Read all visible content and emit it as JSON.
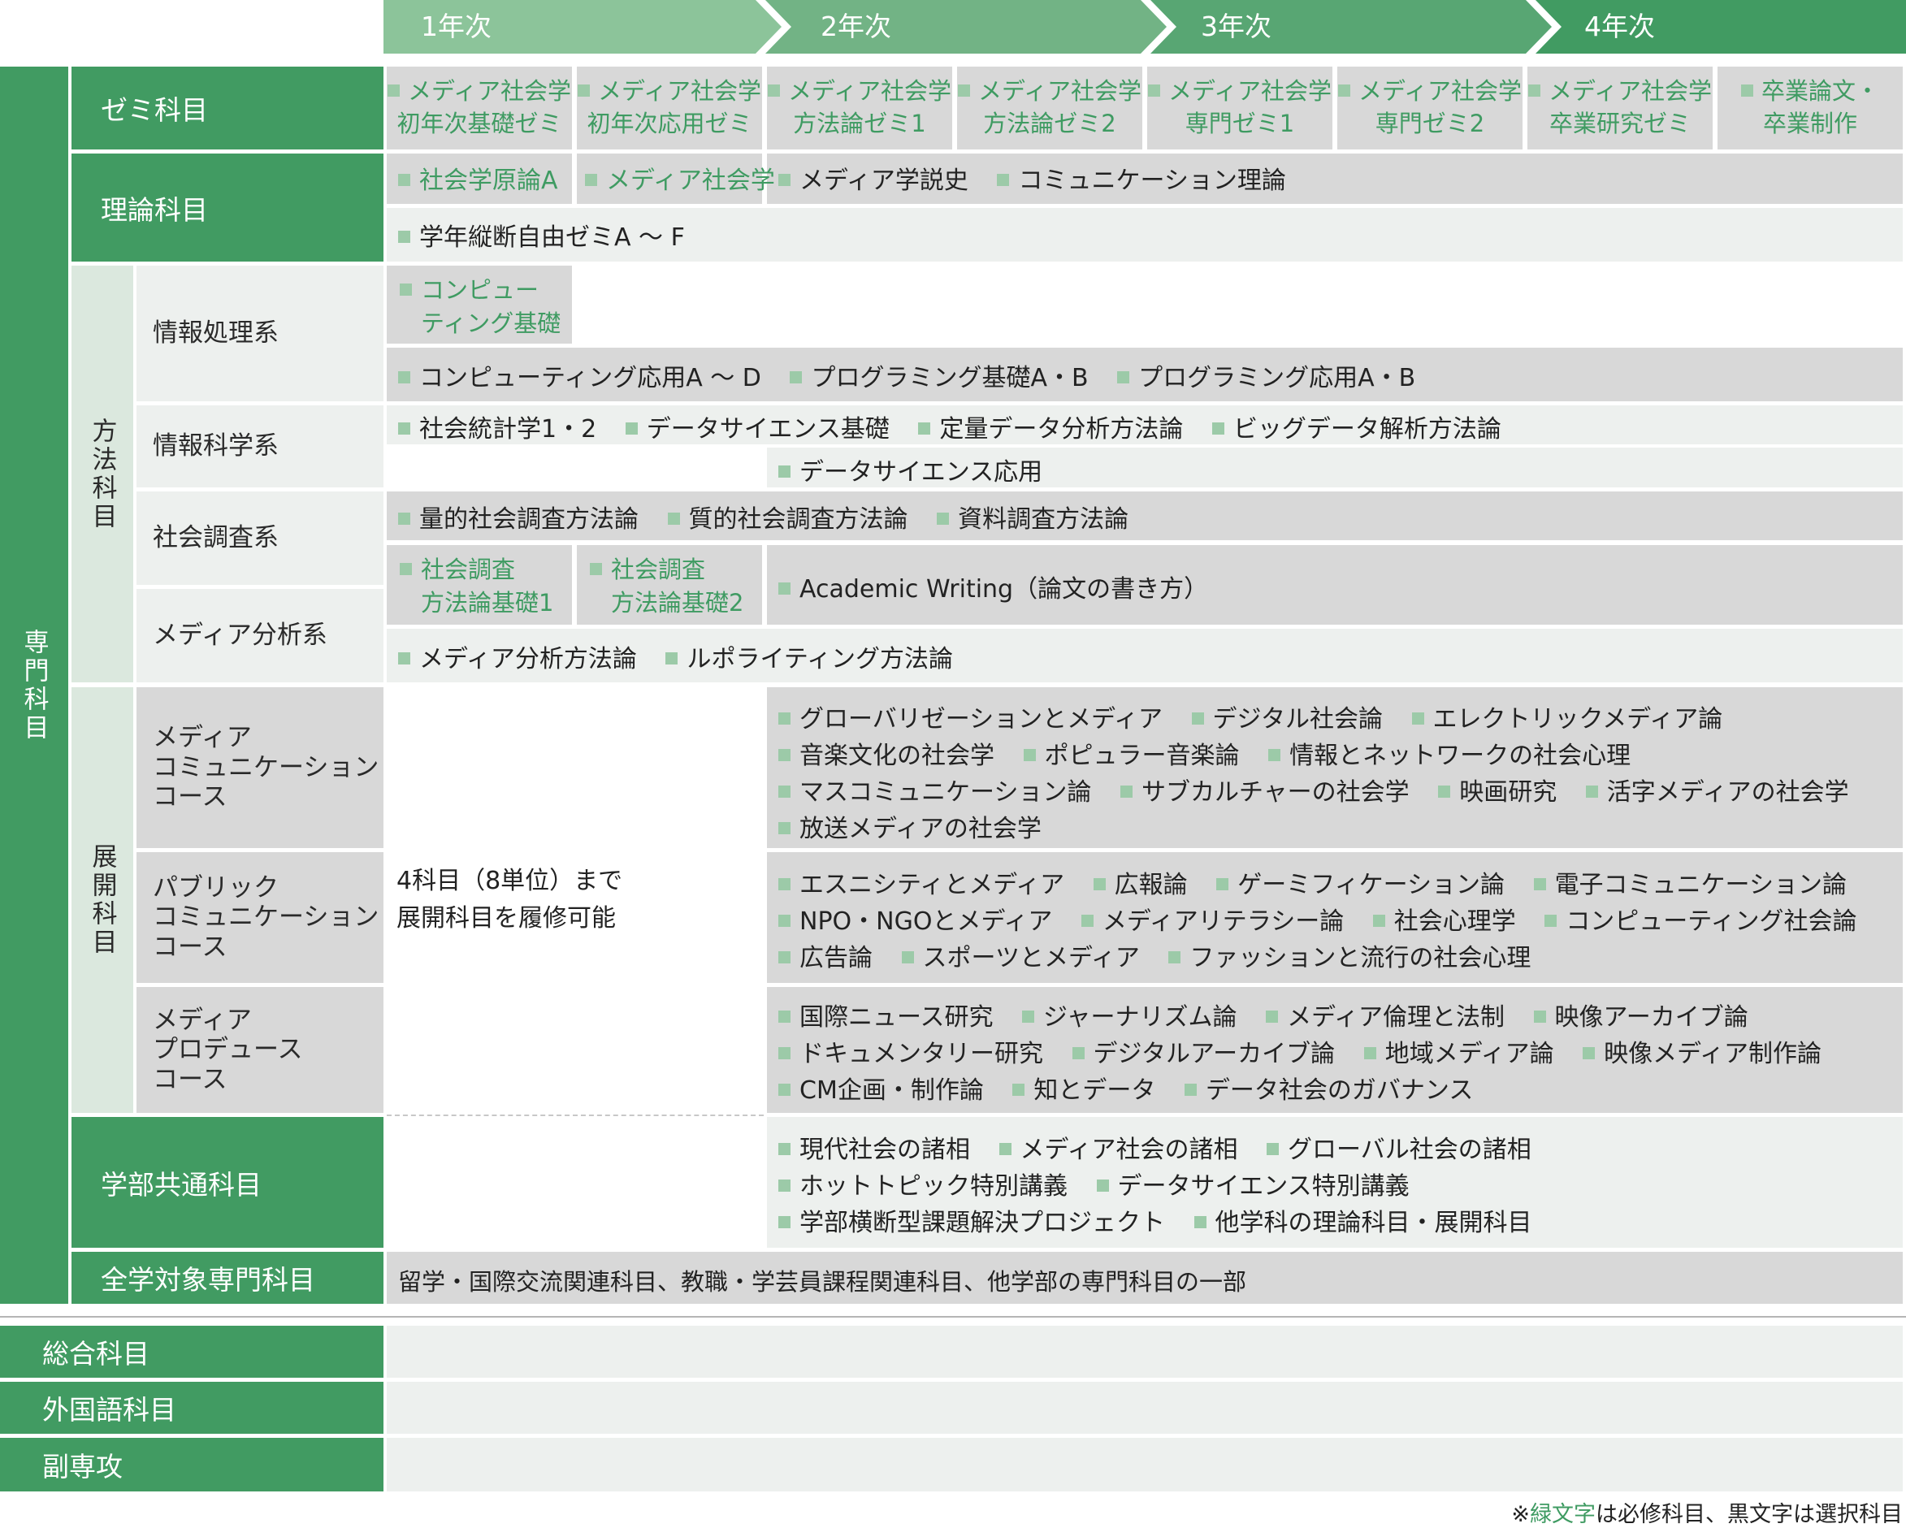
{
  "years": [
    "1年次",
    "2年次",
    "3年次",
    "4年次"
  ],
  "sidebar": {
    "senmon": "専門科目",
    "houhou": "方法科目",
    "tenkai": "展開科目"
  },
  "rows": {
    "zemi": "ゼミ科目",
    "riron": "理論科目",
    "johoshori": "情報処理系",
    "johokagaku": "情報科学系",
    "shakaichosa": "社会調査系",
    "mediabunseki": "メディア分析系",
    "mc": "メディア\nコミュニケーション\nコース",
    "pc": "パブリック\nコミュニケーション\nコース",
    "mp": "メディア\nプロデュース\nコース",
    "gakubu": "学部共通科目",
    "zengaku": "全学対象専門科目",
    "sogo": "総合科目",
    "gaikoku": "外国語科目",
    "fuku": "副専攻"
  },
  "zemi_cells": [
    [
      "メディア社会学",
      "初年次基礎ゼミ"
    ],
    [
      "メディア社会学",
      "初年次応用ゼミ"
    ],
    [
      "メディア社会学",
      "方法論ゼミ1"
    ],
    [
      "メディア社会学",
      "方法論ゼミ2"
    ],
    [
      "メディア社会学",
      "専門ゼミ1"
    ],
    [
      "メディア社会学",
      "専門ゼミ2"
    ],
    [
      "メディア社会学",
      "卒業研究ゼミ"
    ],
    [
      "卒業論文・",
      "卒業制作"
    ]
  ],
  "riron": {
    "req1": "社会学原論A",
    "req2": "メディア社会学",
    "opt": [
      "メディア学説史",
      "コミュニケーション理論"
    ],
    "free": "学年縦断自由ゼミA ～ F"
  },
  "johoshori": {
    "req": [
      "コンピュー",
      "ティング基礎"
    ],
    "opt": [
      "コンピューティング応用A ～ D",
      "プログラミング基礎A・B",
      "プログラミング応用A・B"
    ]
  },
  "johokagaku": {
    "line1": [
      "社会統計学1・2",
      "データサイエンス基礎",
      "定量データ分析方法論",
      "ビッグデータ解析方法論"
    ],
    "line2": [
      "データサイエンス応用"
    ]
  },
  "shakaichosa": {
    "line1": [
      "量的社会調査方法論",
      "質的社会調査方法論",
      "資料調査方法論"
    ],
    "req1": [
      "社会調査",
      "方法論基礎1"
    ],
    "req2": [
      "社会調査",
      "方法論基礎2"
    ],
    "academic": "Academic Writing（論文の書き方）"
  },
  "mediabunseki": {
    "line": [
      "メディア分析方法論",
      "ルポライティング方法論"
    ]
  },
  "tenkai_note": [
    "4科目（8単位）まで",
    "展開科目を履修可能"
  ],
  "mc": [
    [
      "グローバリゼーションとメディア",
      "デジタル社会論",
      "エレクトリックメディア論"
    ],
    [
      "音楽文化の社会学",
      "ポピュラー音楽論",
      "情報とネットワークの社会心理"
    ],
    [
      "マスコミュニケーション論",
      "サブカルチャーの社会学",
      "映画研究",
      "活字メディアの社会学"
    ],
    [
      "放送メディアの社会学"
    ]
  ],
  "pc": [
    [
      "エスニシティとメディア",
      "広報論",
      "ゲーミフィケーション論",
      "電子コミュニケーション論"
    ],
    [
      "NPO・NGOとメディア",
      "メディアリテラシー論",
      "社会心理学",
      "コンピューティング社会論"
    ],
    [
      "広告論",
      "スポーツとメディア",
      "ファッションと流行の社会心理"
    ]
  ],
  "mp": [
    [
      "国際ニュース研究",
      "ジャーナリズム論",
      "メディア倫理と法制",
      "映像アーカイブ論"
    ],
    [
      "ドキュメンタリー研究",
      "デジタルアーカイブ論",
      "地域メディア論",
      "映像メディア制作論"
    ],
    [
      "CM企画・制作論",
      "知とデータ",
      "データ社会のガバナンス"
    ]
  ],
  "gakubu": [
    [
      "現代社会の諸相",
      "メディア社会の諸相",
      "グローバル社会の諸相"
    ],
    [
      "ホットトピック特別講義",
      "データサイエンス特別講義"
    ],
    [
      "学部横断型課題解決プロジェクト",
      "他学科の理論科目・展開科目"
    ]
  ],
  "zengaku_text": "留学・国際交流関連科目、教職・学芸員課程関連科目、他学部の専門科目の一部",
  "footnote": {
    "prefix": "※",
    "green": "緑文字",
    "rest": "は必修科目、黒文字は選択科目"
  },
  "colors": {
    "brand": "#419b62",
    "green_text": "#3f9b62",
    "square": "#9ccaa8"
  }
}
